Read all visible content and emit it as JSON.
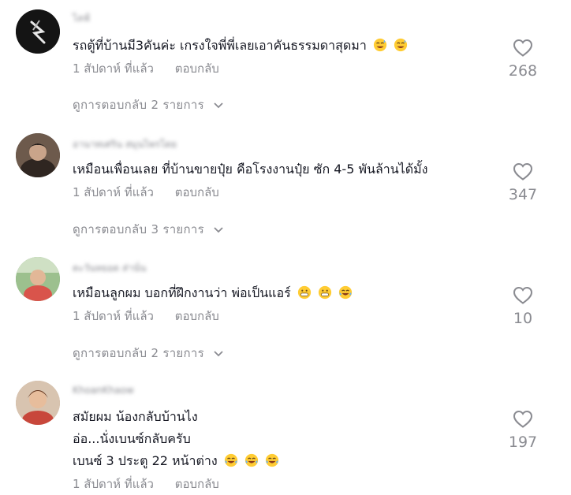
{
  "comments": [
    {
      "username": "ไลฟ์",
      "lines": [
        "รถตู้ที่บ้านมี3คันค่ะ เกรงใจพี่พี่เลยเอาคันธรรมดาสุดมา"
      ],
      "time": "1 สัปดาห์ ที่แล้ว",
      "reply": "ตอบกลับ",
      "likes": "268",
      "view_replies": "ดูการตอบกลับ 2 รายการ"
    },
    {
      "username": "อานาทเศริน สมุนไพรโดย",
      "lines": [
        "เหมือนเพื่อนเลย ที่บ้านขายปุ๋ย คือโรงงานปุ๋ย ซัก 4-5 พันล้านได้มั้ง"
      ],
      "time": "1 สัปดาห์ ที่แล้ว",
      "reply": "ตอบกลับ",
      "likes": "347",
      "view_replies": "ดูการตอบกลับ 3 รายการ"
    },
    {
      "username": "ตะวันหยอด ส่านั่น",
      "lines": [
        "เหมือนลูกผม บอกที่ฝึกงานว่า พ่อเป็นแอร์"
      ],
      "time": "1 สัปดาห์ ที่แล้ว",
      "reply": "ตอบกลับ",
      "likes": "10",
      "view_replies": "ดูการตอบกลับ 2 รายการ"
    },
    {
      "username": "KhoanKhaow",
      "lines": [
        "สมัยผม น้องกลับบ้านไง",
        "อ่อ...นั่งเบนซ์กลับครับ",
        "เบนซ์ 3 ประตู 22 หน้าต่าง"
      ],
      "time": "1 สัปดาห์ ที่แล้ว",
      "reply": "ตอบกลับ",
      "likes": "197"
    }
  ],
  "icons": [
    "heart-outline-icon",
    "chevron-down-icon",
    "sweat-smile-emoji",
    "grin-emoji",
    "tears-of-joy-emoji"
  ],
  "colors": {
    "text": "#161823",
    "secondary": "#8a8b91",
    "emoji": "#ffcc33"
  }
}
